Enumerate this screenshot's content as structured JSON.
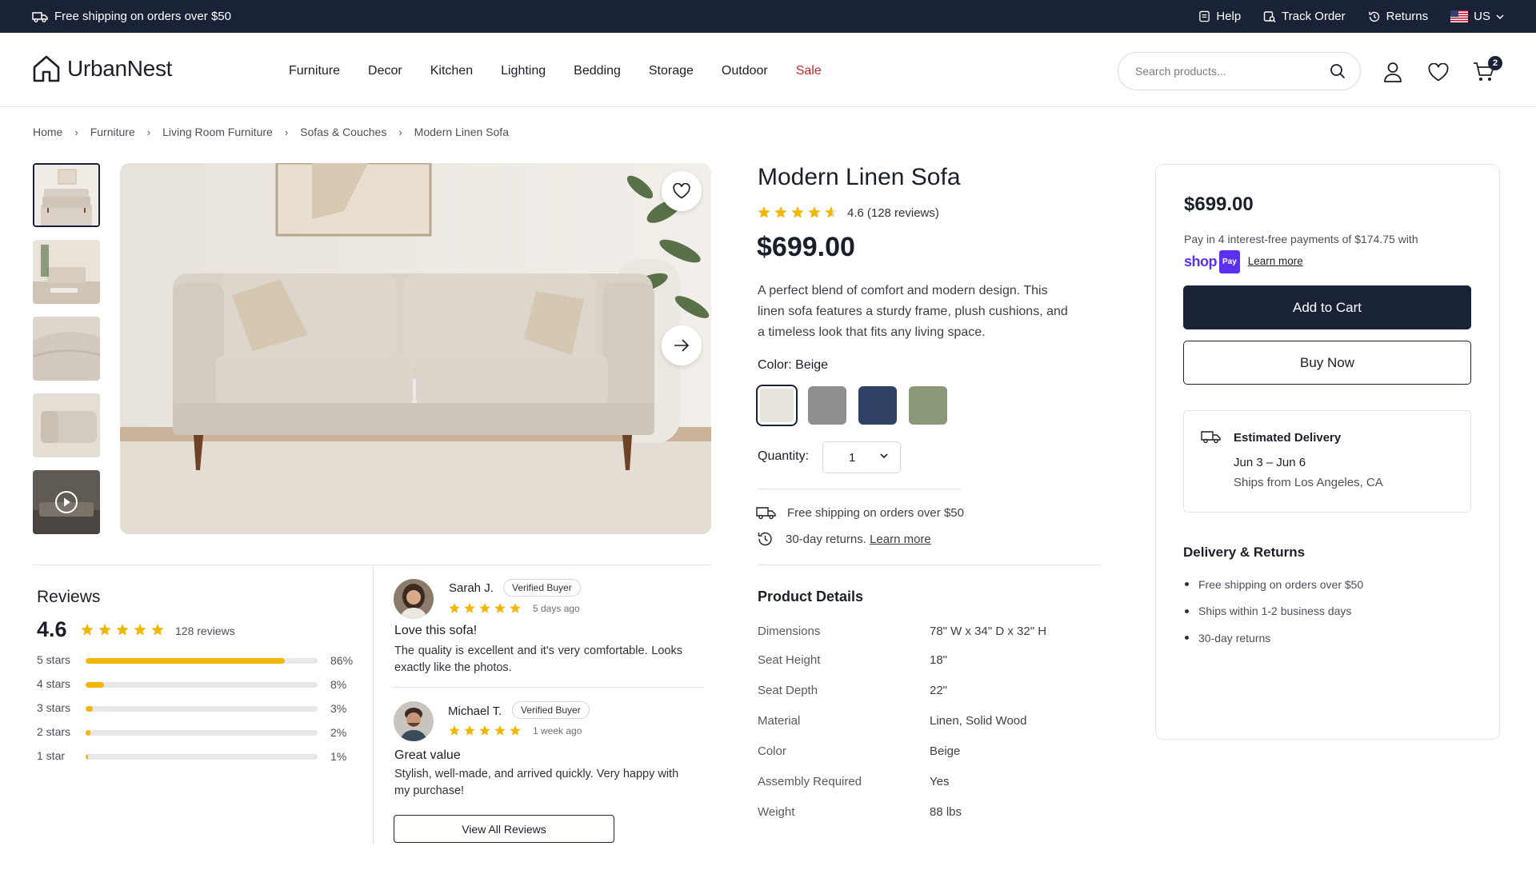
{
  "topbar": {
    "promo": "Free shipping on orders over $50",
    "help": "Help",
    "track_order": "Track Order",
    "returns": "Returns",
    "region": "US"
  },
  "header": {
    "brand": "UrbanNest",
    "nav": [
      "Furniture",
      "Decor",
      "Kitchen",
      "Lighting",
      "Bedding",
      "Storage",
      "Outdoor",
      "Sale"
    ],
    "search_placeholder": "Search products...",
    "cart_count": "2"
  },
  "breadcrumb": [
    "Home",
    "Furniture",
    "Living Room Furniture",
    "Sofas & Couches",
    "Modern Linen Sofa"
  ],
  "product": {
    "title": "Modern Linen Sofa",
    "rating": "4.6",
    "rating_value": 4.6,
    "reviews_text": "(128 reviews)",
    "price": "$699.00",
    "description": "A perfect blend of comfort and modern design. This linen sofa features a sturdy frame, plush cushions, and a timeless look that fits any living space.",
    "color_label": "Color:",
    "color_selected": "Beige",
    "swatches": [
      {
        "name": "Beige",
        "hex": "#e8e4dd"
      },
      {
        "name": "Gray",
        "hex": "#8f8f8f"
      },
      {
        "name": "Navy",
        "hex": "#2f4266"
      },
      {
        "name": "Sage",
        "hex": "#8a9877"
      }
    ],
    "quantity_label": "Quantity:",
    "quantity": "1",
    "perks": {
      "shipping": "Free shipping on orders over $50",
      "returns": "30-day returns.",
      "returns_link": "Learn more"
    }
  },
  "details": {
    "title": "Product Details",
    "rows": [
      {
        "label": "Dimensions",
        "value": "78\" W x 34\" D x 32\" H"
      },
      {
        "label": "Seat Height",
        "value": "18\""
      },
      {
        "label": "Seat Depth",
        "value": "22\""
      },
      {
        "label": "Material",
        "value": "Linen, Solid Wood"
      },
      {
        "label": "Color",
        "value": "Beige"
      },
      {
        "label": "Assembly Required",
        "value": "Yes"
      },
      {
        "label": "Weight",
        "value": "88 lbs"
      }
    ]
  },
  "purchase": {
    "price": "$699.00",
    "installments": "Pay in 4 interest-free payments of $174.75 with",
    "shop_text": "shop",
    "pay_badge": "Pay",
    "learn_more": "Learn more",
    "add_to_cart": "Add to Cart",
    "buy_now": "Buy Now",
    "delivery_title": "Estimated Delivery",
    "delivery_dates": "Jun 3 – Jun 6",
    "ships_from": "Ships from Los Angeles, CA",
    "dr_title": "Delivery & Returns",
    "dr_items": [
      "Free shipping on orders over $50",
      "Ships within 1-2 business days",
      "30-day returns"
    ]
  },
  "reviews": {
    "title": "Reviews",
    "average": "4.6",
    "count": "128 reviews",
    "distribution": [
      {
        "label": "5 stars",
        "pct": "86%",
        "value": 86
      },
      {
        "label": "4 stars",
        "pct": "8%",
        "value": 8
      },
      {
        "label": "3 stars",
        "pct": "3%",
        "value": 3
      },
      {
        "label": "2 stars",
        "pct": "2%",
        "value": 2
      },
      {
        "label": "1 star",
        "pct": "1%",
        "value": 1
      }
    ],
    "items": [
      {
        "name": "Sarah J.",
        "badge": "Verified Buyer",
        "stars": 5,
        "time": "5 days ago",
        "headline": "Love this sofa!",
        "body": "The quality is excellent and it's very comfortable. Looks exactly like the photos."
      },
      {
        "name": "Michael T.",
        "badge": "Verified Buyer",
        "stars": 5,
        "time": "1 week ago",
        "headline": "Great value",
        "body": "Stylish, well-made, and arrived quickly. Very happy with my purchase!"
      }
    ],
    "view_all": "View All Reviews"
  },
  "colors": {
    "navy": "#1a2238",
    "star": "#f2b705",
    "sale": "#c0282d",
    "shoppay": "#5a31f4"
  }
}
